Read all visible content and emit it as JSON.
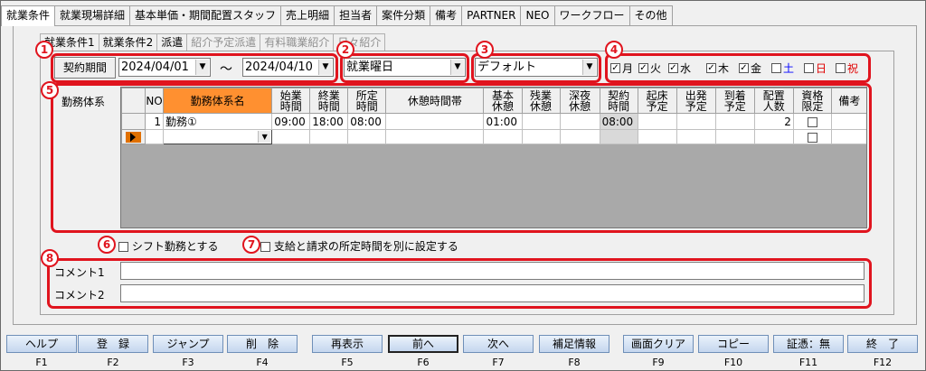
{
  "top_tabs": [
    "就業条件",
    "就業現場詳細",
    "基本単価・期間配置スタッフ",
    "売上明細",
    "担当者",
    "案件分類",
    "備考",
    "PARTNER",
    "NEO",
    "ワークフロー",
    "その他"
  ],
  "sub_tabs": [
    "就業条件1",
    "就業条件2",
    "派遣",
    "紹介予定派遣",
    "有料職業紹介",
    "日々紹介"
  ],
  "annotations": [
    "1",
    "2",
    "3",
    "4",
    "5",
    "6",
    "7",
    "8"
  ],
  "period": {
    "button": "契約期間",
    "from": "2024/04/01",
    "sep": "～",
    "to": "2024/04/10"
  },
  "day_type": "就業曜日",
  "pattern": "デフォルト",
  "weekdays": [
    {
      "label": "月",
      "checked": true,
      "color": "#000000"
    },
    {
      "label": "火",
      "checked": true,
      "color": "#000000"
    },
    {
      "label": "水",
      "checked": true,
      "color": "#000000"
    },
    {
      "label": "木",
      "checked": true,
      "color": "#000000"
    },
    {
      "label": "金",
      "checked": true,
      "color": "#000000"
    },
    {
      "label": "土",
      "checked": false,
      "color": "#0000ff"
    },
    {
      "label": "日",
      "checked": false,
      "color": "#e00000"
    },
    {
      "label": "祝",
      "checked": false,
      "color": "#e00000"
    }
  ],
  "work_section_label": "勤務体系",
  "grid": {
    "headers": [
      "NO",
      "勤務体系名",
      "始業\n時間",
      "終業\n時間",
      "所定\n時間",
      "休憩時間帯",
      "基本\n休憩",
      "残業\n休憩",
      "深夜\n休憩",
      "契約\n時間",
      "起床\n予定",
      "出発\n予定",
      "到着\n予定",
      "配置\n人数",
      "資格\n限定",
      "備考"
    ],
    "rows": [
      {
        "no": "1",
        "name": "勤務①",
        "start": "09:00",
        "end": "18:00",
        "fixed": "08:00",
        "break_band": "",
        "basic_break": "01:00",
        "ot_break": "",
        "night_break": "",
        "contract": "08:00",
        "wake": "",
        "depart": "",
        "arrive": "",
        "staff": "2",
        "qual": false,
        "note": ""
      }
    ]
  },
  "shift_label": "シフト勤務とする",
  "separate_label": "支給と請求の所定時間を別に設定する",
  "comments": [
    "コメント1",
    "コメント2"
  ],
  "fkeys": [
    {
      "label": "ヘルプ",
      "key": "F1"
    },
    {
      "label": "登　録",
      "key": "F2"
    },
    {
      "label": "ジャンプ",
      "key": "F3"
    },
    {
      "label": "削　除",
      "key": "F4"
    },
    {
      "label": "再表示",
      "key": "F5"
    },
    {
      "label": "前へ",
      "key": "F6"
    },
    {
      "label": "次へ",
      "key": "F7"
    },
    {
      "label": "補足情報",
      "key": "F8"
    },
    {
      "label": "画面クリア",
      "key": "F9"
    },
    {
      "label": "コピー",
      "key": "F10"
    },
    {
      "label": "証憑：無",
      "key": "F11"
    },
    {
      "label": "終　了",
      "key": "F12"
    }
  ]
}
